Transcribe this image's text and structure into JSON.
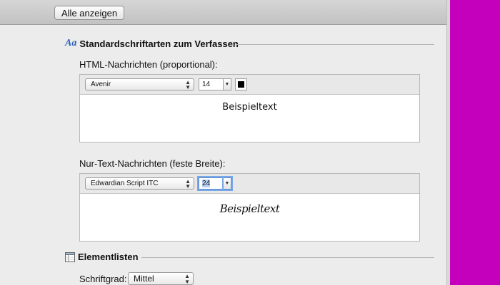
{
  "toolbar": {
    "show_all_label": "Alle anzeigen"
  },
  "compose_fonts": {
    "title": "Standardschriftarten zum Verfassen",
    "html": {
      "label": "HTML-Nachrichten (proportional):",
      "font": "Avenir",
      "size": "14",
      "color": "#000000",
      "preview": "Beispieltext"
    },
    "plain": {
      "label": "Nur-Text-Nachrichten (feste Breite):",
      "font": "Edwardian Script ITC",
      "size": "24",
      "preview": "Beispieltext"
    }
  },
  "element_lists": {
    "title": "Elementlisten",
    "size_label": "Schriftgrad:",
    "size_value": "Mittel"
  }
}
